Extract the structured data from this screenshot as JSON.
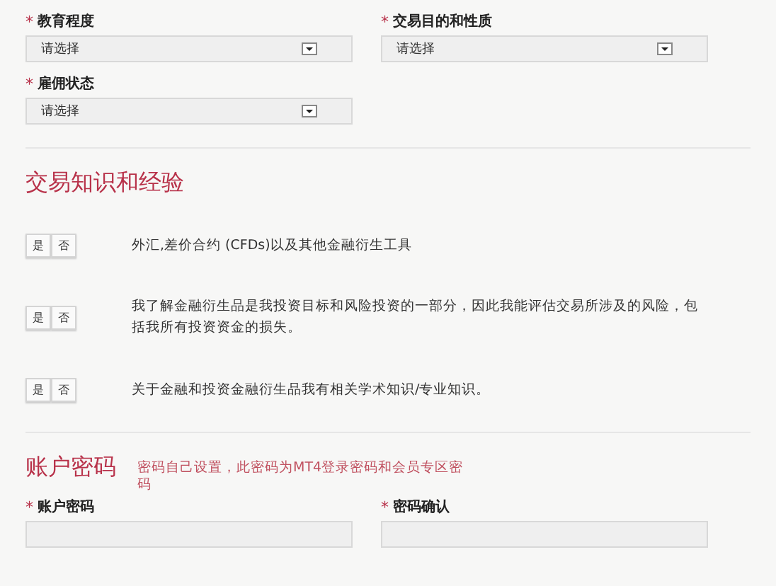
{
  "profile_fields": [
    {
      "mark": "*",
      "label": "教育程度",
      "value": "请选择"
    },
    {
      "mark": "*",
      "label": "交易目的和性质",
      "value": "请选择"
    },
    {
      "mark": "*",
      "label": "雇佣状态",
      "value": "请选择"
    }
  ],
  "knowledge": {
    "title": "交易知识和经验",
    "questions": [
      {
        "yes": "是",
        "no": "否",
        "text": "外汇,差价合约 (CFDs)以及其他金融衍生工具"
      },
      {
        "yes": "是",
        "no": "否",
        "text": "我了解金融衍生品是我投资目标和风险投资的一部分，因此我能评估交易所涉及的风险，包括我所有投资资金的损失。"
      },
      {
        "yes": "是",
        "no": "否",
        "text": "关于金融和投资金融衍生品我有相关学术知识/专业知识。"
      }
    ]
  },
  "password": {
    "title": "账户密码",
    "note": "密码自己设置，此密码为MT4登录密码和会员专区密码",
    "fields": [
      {
        "mark": "*",
        "label": "账户密码"
      },
      {
        "mark": "*",
        "label": "密码确认"
      }
    ]
  }
}
